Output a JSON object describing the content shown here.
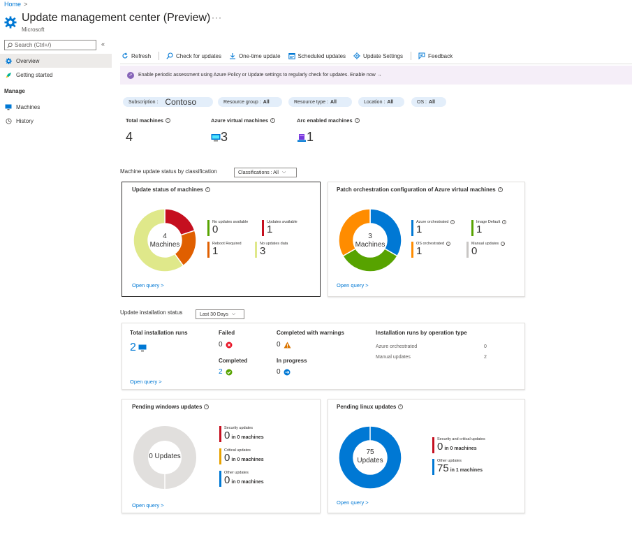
{
  "breadcrumb": {
    "home": "Home",
    "sep": ">"
  },
  "header": {
    "title": "Update management center (Preview)",
    "more": "···",
    "subtitle": "Microsoft"
  },
  "sidebar": {
    "search_placeholder": "Search (Ctrl+/)",
    "collapse": "«",
    "items": [
      {
        "label": "Overview",
        "icon": "gear-icon"
      },
      {
        "label": "Getting started",
        "icon": "rocket-icon"
      }
    ],
    "manage_heading": "Manage",
    "manage_items": [
      {
        "label": "Machines",
        "icon": "monitor-icon"
      },
      {
        "label": "History",
        "icon": "clock-icon"
      }
    ]
  },
  "toolbar": {
    "refresh": "Refresh",
    "check": "Check for updates",
    "onetime": "One-time update",
    "scheduled": "Scheduled updates",
    "settings": "Update Settings",
    "feedback": "Feedback"
  },
  "banner": {
    "text": "Enable periodic assessment using Azure Policy or Update settings to regularly check for updates. Enable now →"
  },
  "filters": {
    "subscription_label": "Subscription :",
    "subscription_value": "Contoso",
    "resource_group_label": "Resource group :",
    "resource_group_value": "All",
    "resource_type_label": "Resource type :",
    "resource_type_value": "All",
    "location_label": "Location :",
    "location_value": "All",
    "os_label": "OS :",
    "os_value": "All"
  },
  "kpis": {
    "total_label": "Total machines",
    "total_value": "4",
    "azure_label": "Azure virtual machines",
    "azure_value": "3",
    "arc_label": "Arc enabled machines",
    "arc_value": "1"
  },
  "classification": {
    "label": "Machine update status by classification",
    "dropdown": "Classifications : All"
  },
  "update_status": {
    "title": "Update status of machines",
    "center_value": "4",
    "center_label": "Machines",
    "legend": [
      {
        "label": "No updates available",
        "value": "0",
        "color": "#57a300"
      },
      {
        "label": "Updates available",
        "value": "1",
        "color": "#c50f1f"
      },
      {
        "label": "Reboot Required",
        "value": "1",
        "color": "#e05f00"
      },
      {
        "label": "No updates data",
        "value": "3",
        "color": "#dfe88a"
      }
    ],
    "open_query": "Open query >"
  },
  "patch": {
    "title": "Patch orchestration configuration of Azure virtual machines",
    "center_value": "3",
    "center_label": "Machines",
    "legend": [
      {
        "label": "Azure orchestrated",
        "value": "1",
        "color": "#0078d4"
      },
      {
        "label": "Image Default",
        "value": "1",
        "color": "#57a300"
      },
      {
        "label": "OS orchestrated",
        "value": "1",
        "color": "#ff8c00"
      },
      {
        "label": "Manual updates",
        "value": "0",
        "color": "#c8c6c4"
      }
    ],
    "open_query": "Open query >"
  },
  "install": {
    "label": "Update installation status",
    "dropdown": "Last 30 Days",
    "total_label": "Total installation runs",
    "total_value": "2",
    "failed_label": "Failed",
    "failed_value": "0",
    "completed_label": "Completed",
    "completed_value": "2",
    "warnings_label": "Completed with warnings",
    "warnings_value": "0",
    "progress_label": "In progress",
    "progress_value": "0",
    "op_title": "Installation runs by operation type",
    "op_rows": [
      {
        "label": "Azure orchestrated",
        "value": "0"
      },
      {
        "label": "Manual updates",
        "value": "2"
      }
    ],
    "open_query": "Open query >"
  },
  "pending_windows": {
    "title": "Pending windows updates",
    "center": "0 Updates",
    "legend": [
      {
        "label": "Security updates",
        "value": "0",
        "machines": "in 0 machines",
        "color": "#c50f1f"
      },
      {
        "label": "Critical updates",
        "value": "0",
        "machines": "in 0 machines",
        "color": "#e8a200"
      },
      {
        "label": "Other updates",
        "value": "0",
        "machines": "in 0 machines",
        "color": "#0078d4"
      }
    ],
    "open_query": "Open query >"
  },
  "pending_linux": {
    "title": "Pending linux updates",
    "center_value": "75",
    "center_label": "Updates",
    "legend": [
      {
        "label": "Security and critical updates",
        "value": "0",
        "machines": "in 0 machines",
        "color": "#c50f1f"
      },
      {
        "label": "Other updates",
        "value": "75",
        "machines": "in 1 machines",
        "color": "#0078d4"
      }
    ],
    "open_query": "Open query >"
  }
}
